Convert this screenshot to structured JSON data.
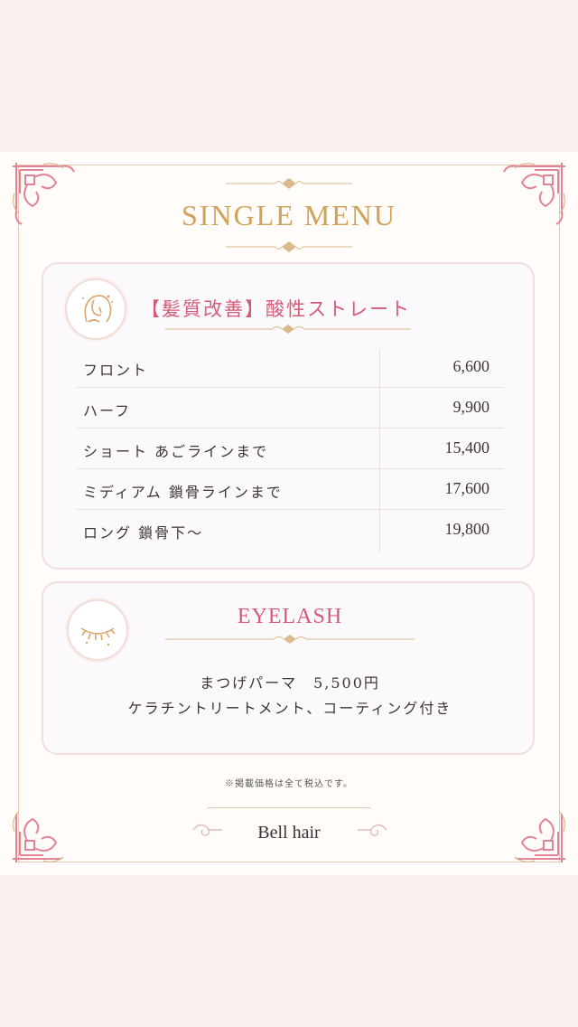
{
  "card": {
    "title": "SINGLE MENU"
  },
  "straight_menu": {
    "icon": "woman-face-icon",
    "title": "【髪質改善】酸性ストレート",
    "items": [
      {
        "name": "フロント",
        "price": "6,600"
      },
      {
        "name": "ハーフ",
        "price": "9,900"
      },
      {
        "name": "ショート あごラインまで",
        "price": "15,400"
      },
      {
        "name": "ミディアム 鎖骨ラインまで",
        "price": "17,600"
      },
      {
        "name": "ロング 鎖骨下〜",
        "price": "19,800"
      }
    ]
  },
  "eyelash_menu": {
    "icon": "closed-eye-lashes-icon",
    "title": "EYELASH",
    "line1": "まつげパーマ　5,500円",
    "line2": "ケラチントリートメント、コーティング付き"
  },
  "footer": {
    "note": "※掲載価格は全て税込です。",
    "brand": "Bell hair"
  },
  "colors": {
    "gold": "#d0a25a",
    "pink": "#d65a74",
    "corner_pink": "#e38398",
    "background": "#f8f1ee"
  }
}
